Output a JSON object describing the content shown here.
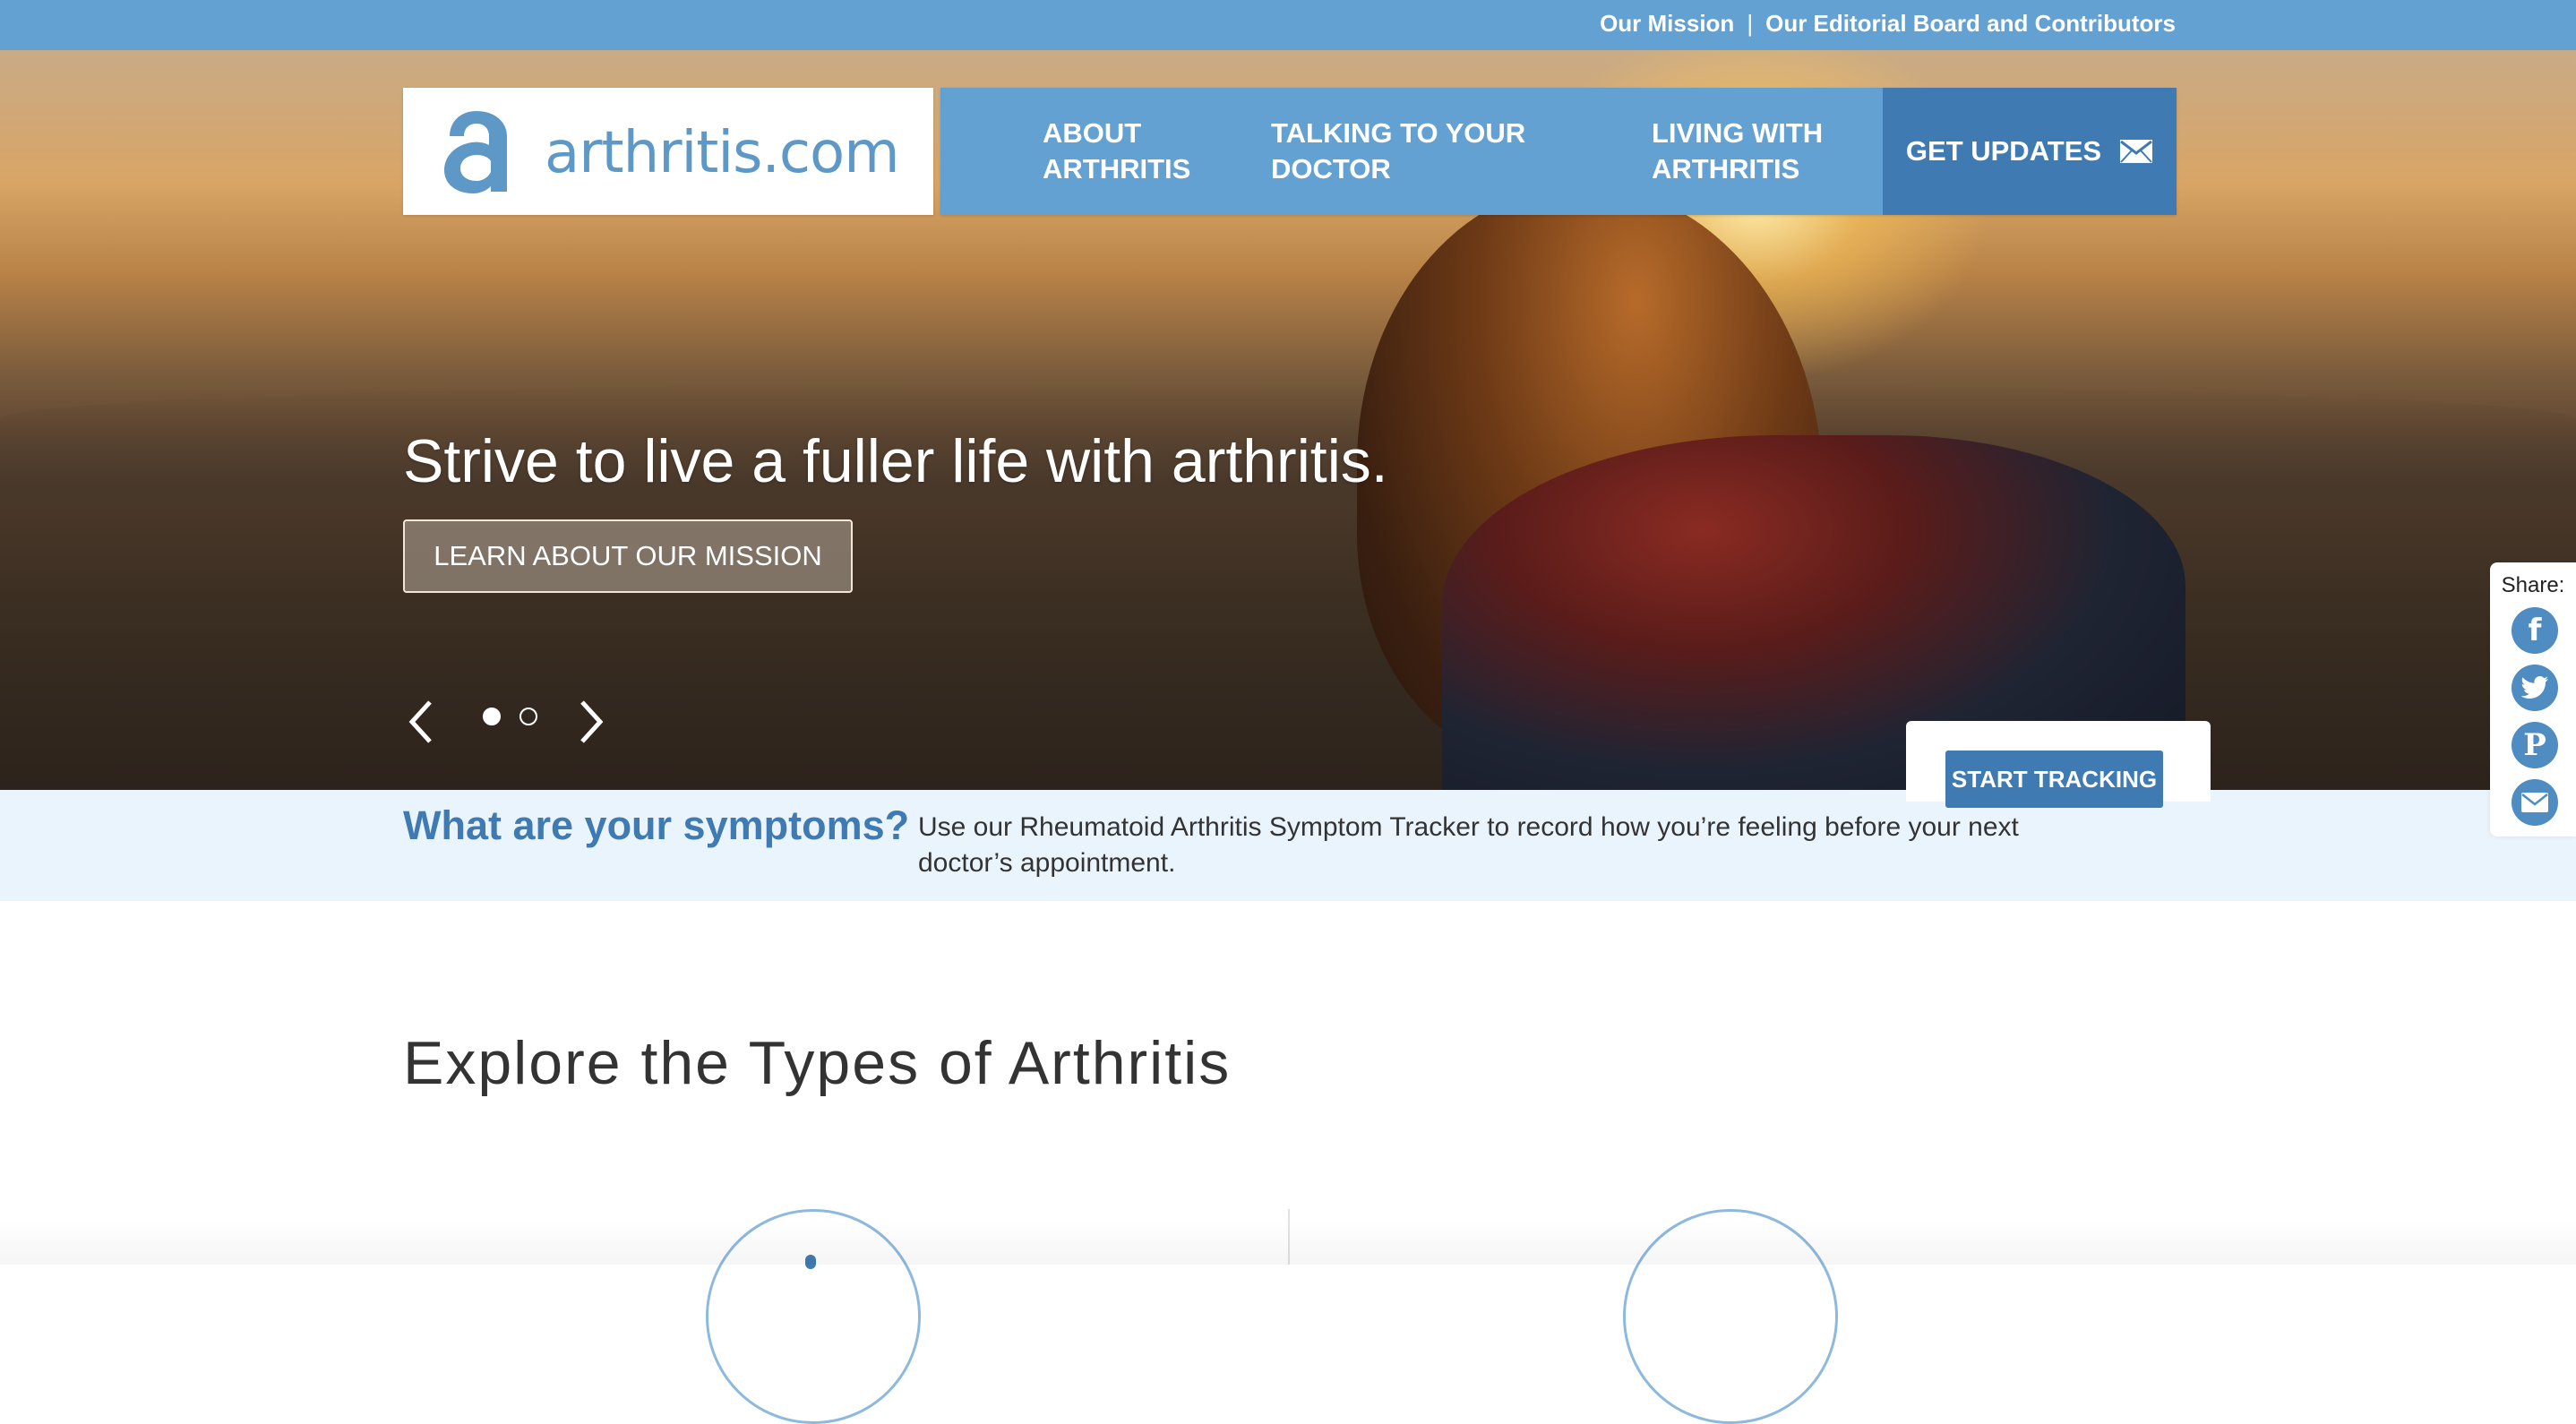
{
  "topbar": {
    "mission_link": "Our Mission",
    "separator": "|",
    "editorial_link": "Our Editorial Board and Contributors"
  },
  "logo": {
    "text": "arthritis.com",
    "icon": "arthritis-logo-icon"
  },
  "nav": {
    "items": [
      {
        "label": "ABOUT ARTHRITIS"
      },
      {
        "label": "TALKING TO YOUR DOCTOR"
      },
      {
        "label": "LIVING WITH ARTHRITIS"
      }
    ],
    "updates_label": "GET UPDATES",
    "updates_icon": "envelope-icon"
  },
  "hero": {
    "headline": "Strive to live a fuller life with arthritis.",
    "cta_label": "LEARN ABOUT OUR MISSION",
    "slides": {
      "count": 2,
      "active": 1
    },
    "prev_icon": "chevron-left-icon",
    "next_icon": "chevron-right-icon"
  },
  "symptoms": {
    "question": "What are your symptoms?",
    "description": "Use our Rheumatoid Arthritis Symptom Tracker to record how you’re feeling before your next doctor’s appointment.",
    "button_label": "START TRACKING"
  },
  "share": {
    "label": "Share:",
    "icons": [
      "facebook-icon",
      "twitter-icon",
      "pinterest-icon",
      "email-icon"
    ]
  },
  "explore": {
    "title": "Explore the Types of Arthritis"
  },
  "colors": {
    "brand_blue": "#64a1d3",
    "dark_blue": "#3f7bb2",
    "light_band": "#eaf4fc",
    "logo_blue": "#5e98c6"
  }
}
